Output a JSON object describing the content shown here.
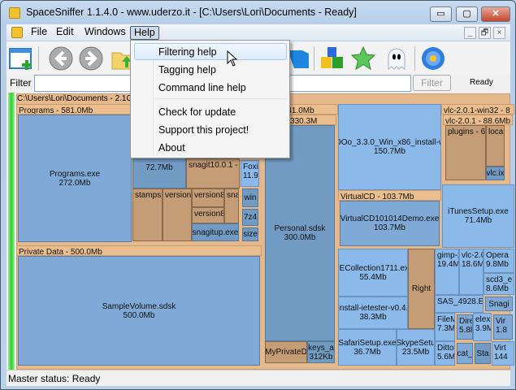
{
  "window": {
    "title": "SpaceSniffer 1.1.4.0 - www.uderzo.it - [C:\\Users\\Lori\\Documents - Ready]",
    "min": "▭",
    "max": "▢",
    "close": "✕"
  },
  "menubar": {
    "items": [
      "File",
      "Edit",
      "Windows",
      "Help"
    ],
    "mdi": [
      "_",
      "🗗",
      "×"
    ]
  },
  "toolbar": {
    "icons": [
      "new-window",
      "back",
      "forward",
      "folder-up",
      "cube",
      "blocks",
      "star",
      "ghost",
      "flower"
    ]
  },
  "filter": {
    "label": "Filter",
    "value": "",
    "button": "Filter",
    "status": "Ready"
  },
  "help_menu": {
    "items": [
      "Filtering help",
      "Tagging help",
      "Command line help",
      "Check for update",
      "Support this project!",
      "About"
    ]
  },
  "treemap": {
    "root": "C:\\Users\\Lori\\Documents - 2.1Gb",
    "tiles": [
      {
        "name": "Programs - 581.0Mb",
        "kind": "hdr"
      },
      {
        "name": "Programs.exe",
        "size": "272.0Mb",
        "kind": "file"
      },
      {
        "name": "",
        "size": "72.7Mb",
        "kind": "dk"
      },
      {
        "name": "snagit10.0.1 - 3",
        "kind": "dir"
      },
      {
        "name": "Foxit",
        "size": "11.9I",
        "kind": "lt"
      },
      {
        "name": "stamps -",
        "kind": "dir"
      },
      {
        "name": "version9",
        "kind": "dir"
      },
      {
        "name": "version8.",
        "kind": "dir"
      },
      {
        "name": "version8t",
        "kind": "dir"
      },
      {
        "name": "sna",
        "kind": "dir"
      },
      {
        "name": "snagitup.exe",
        "kind": "dk"
      },
      {
        "name": "win",
        "kind": "dk"
      },
      {
        "name": "7z4",
        "kind": "dk"
      },
      {
        "name": "size",
        "kind": "dk"
      },
      {
        "name": "Private Data - 500.0Mb",
        "kind": "hdr"
      },
      {
        "name": "SampleVolume.sdsk",
        "size": "500.0Mb",
        "kind": "file"
      },
      {
        "name": "ork - 341.0Mb",
        "kind": "hdr"
      },
      {
        "name": "Data - 330.3M",
        "kind": "hdr"
      },
      {
        "name": "Personal.sdsk",
        "size": "300.0Mb",
        "kind": "dk"
      },
      {
        "name": "MyPrivateD",
        "kind": "dir"
      },
      {
        "name": "keys_a",
        "size": "312Kb",
        "kind": "dk"
      },
      {
        "name": "OOo_3.3.0_Win_x86_install-w",
        "size": "150.7Mb",
        "kind": "lt"
      },
      {
        "name": "vlc-2.0.1-win32 - 8",
        "kind": "hdr"
      },
      {
        "name": "vlc-2.0.1 - 88.6Mb",
        "kind": "hdr"
      },
      {
        "name": "plugins - 60",
        "kind": "dir"
      },
      {
        "name": "local",
        "kind": "dir"
      },
      {
        "name": "vlc.ix",
        "kind": "dk"
      },
      {
        "name": "VirtualCD - 103.7Mb",
        "kind": "hdr"
      },
      {
        "name": "VirtualCD101014Demo.exe",
        "size": "103.7Mb",
        "kind": "file"
      },
      {
        "name": "iTunesSetup.exe",
        "size": "71.4Mb",
        "kind": "lt"
      },
      {
        "name": "IECollection1711.ex",
        "size": "55.4Mb",
        "kind": "lt"
      },
      {
        "name": "install-ietester-v0.4.",
        "size": "38.3Mb",
        "kind": "lt"
      },
      {
        "name": "SafariSetup.exe",
        "size": "36.7Mb",
        "kind": "lt"
      },
      {
        "name": "SkypeSetu",
        "size": "23.5Mb",
        "kind": "lt"
      },
      {
        "name": "Right",
        "kind": "dir"
      },
      {
        "name": "gimp-2",
        "size": "19.4Ml",
        "kind": "lt"
      },
      {
        "name": "vlc-2.0",
        "size": "18.6M",
        "kind": "lt"
      },
      {
        "name": "Opera",
        "size": "9.8Mb",
        "kind": "lt"
      },
      {
        "name": "scd3_e",
        "size": "8.6Mb",
        "kind": "lt"
      },
      {
        "name": "SAS_4928.EX",
        "kind": "lt"
      },
      {
        "name": "Snagi",
        "kind": "file"
      },
      {
        "name": "FileM",
        "size": "7.3Ml",
        "kind": "lt"
      },
      {
        "name": "Dire",
        "size": "5.8l",
        "kind": "file"
      },
      {
        "name": "elex.",
        "size": "3.9M",
        "kind": "lt"
      },
      {
        "name": "Vir",
        "size": "1.8",
        "kind": "file"
      },
      {
        "name": "Ditto",
        "size": "5.6M",
        "kind": "lt"
      },
      {
        "name": "cat_",
        "kind": "file"
      },
      {
        "name": "Sta",
        "kind": "dk"
      },
      {
        "name": "Virt",
        "size": "144",
        "kind": "lt"
      }
    ]
  },
  "status": "Master status: Ready"
}
